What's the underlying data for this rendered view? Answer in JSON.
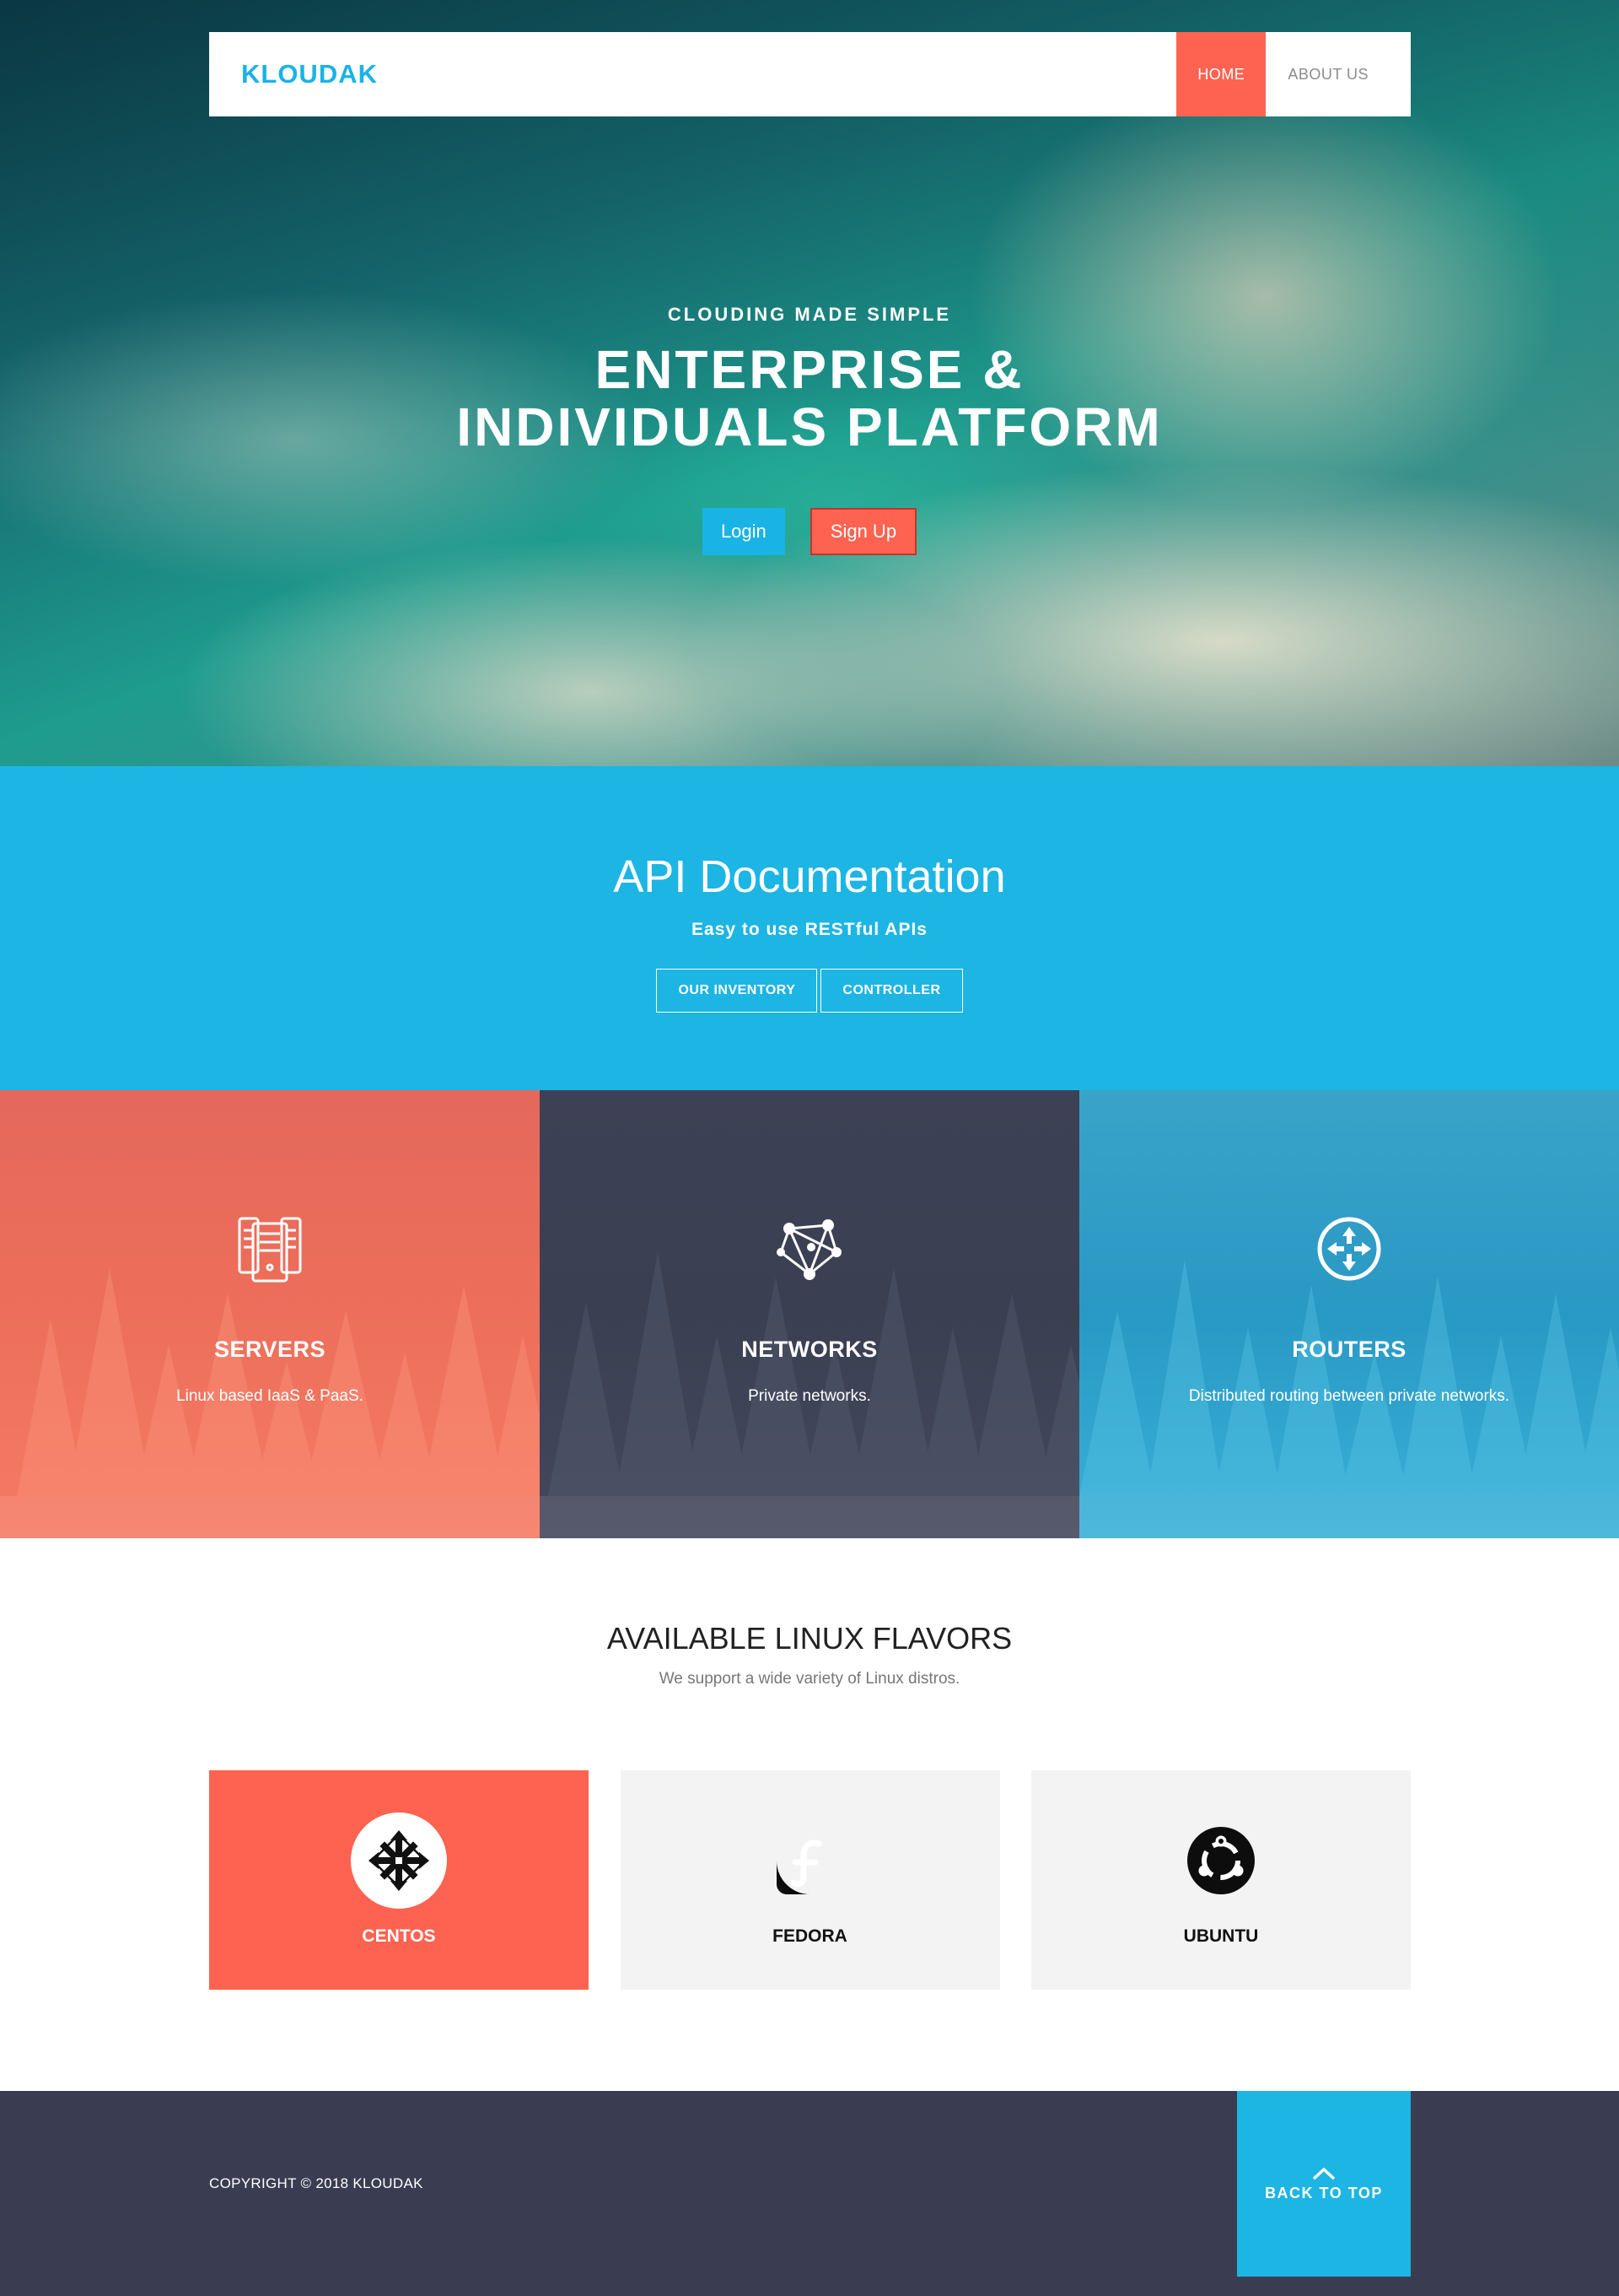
{
  "nav": {
    "brand": "KLOUDAK",
    "links": [
      {
        "label": "HOME",
        "active": true
      },
      {
        "label": "ABOUT US",
        "active": false
      }
    ]
  },
  "hero": {
    "kicker": "CLOUDING MADE SIMPLE",
    "title_line1": "ENTERPRISE &",
    "title_line2": "INDIVIDUALS PLATFORM",
    "login_label": "Login",
    "signup_label": "Sign Up"
  },
  "api": {
    "title": "API Documentation",
    "subtitle": "Easy to use RESTful APIs",
    "buttons": [
      "OUR INVENTORY",
      "CONTROLLER"
    ]
  },
  "features": [
    {
      "icon": "server-icon",
      "title": "SERVERS",
      "desc": "Linux based IaaS & PaaS."
    },
    {
      "icon": "network-icon",
      "title": "NETWORKS",
      "desc": "Private networks."
    },
    {
      "icon": "router-icon",
      "title": "ROUTERS",
      "desc": "Distributed routing between private networks."
    }
  ],
  "linux": {
    "title": "AVAILABLE LINUX FLAVORS",
    "subtitle": "We support a wide variety of Linux distros.",
    "distros": [
      {
        "name": "CENTOS",
        "icon": "centos-logo-icon",
        "selected": true
      },
      {
        "name": "FEDORA",
        "icon": "fedora-logo-icon",
        "selected": false
      },
      {
        "name": "UBUNTU",
        "icon": "ubuntu-logo-icon",
        "selected": false
      }
    ]
  },
  "footer": {
    "copyright": "COPYRIGHT © 2018 KLOUDAK",
    "back_to_top": "BACK TO TOP"
  },
  "colors": {
    "accent_blue": "#1db5e4",
    "accent_coral": "#fd6350",
    "footer_dark": "#3a3d51"
  }
}
